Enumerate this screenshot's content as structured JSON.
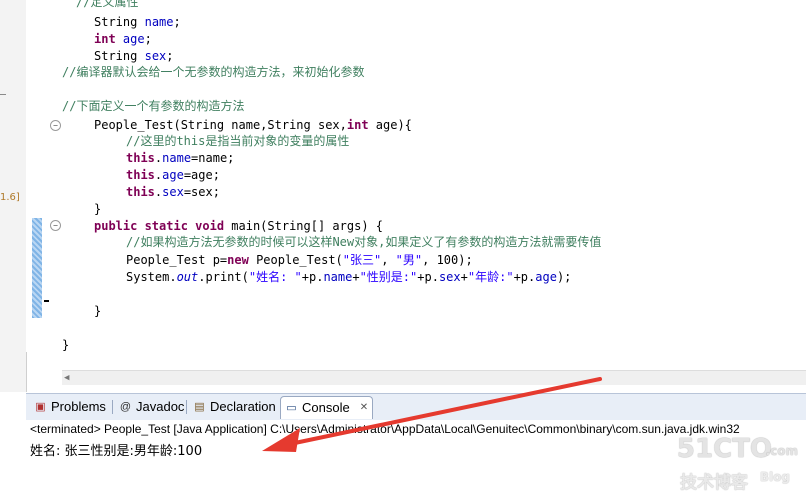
{
  "left_fragment": "1.6]",
  "code": {
    "l0": "//定义属性",
    "l1_type": "String",
    "l1_var": "name",
    "l1_end": ";",
    "l2_type": "int",
    "l2_var": "age",
    "l2_end": ";",
    "l3_type": "String",
    "l3_var": "sex",
    "l3_end": ";",
    "l4": "//编译器默认会给一个无参数的构造方法，来初始化参数",
    "l5": "//下面定义一个有参数的构造方法",
    "l6a": "People_Test(String name,String sex,",
    "l6b": "int",
    "l6c": " age){",
    "l7": "//这里的this是指当前对象的变量的属性",
    "l8a": "this",
    "l8b": ".",
    "l8c": "name",
    "l8d": "=name;",
    "l9a": "this",
    "l9b": ".",
    "l9c": "age",
    "l9d": "=age;",
    "l10a": "this",
    "l10b": ".",
    "l10c": "sex",
    "l10d": "=sex;",
    "l11": "}",
    "l12a": "public static void",
    "l12b": " main(String[] args) {",
    "l13": "//如果构造方法无参数的时候可以这样New对象,如果定义了有参数的构造方法就需要传值",
    "l14a": "People_Test p=",
    "l14b": "new",
    "l14c": " People_Test(",
    "l14d": "\"张三\"",
    "l14e": ", ",
    "l14f": "\"男\"",
    "l14g": ", 100);",
    "l15a": "System.",
    "l15b": "out",
    "l15c": ".print(",
    "l15d": "\"姓名: \"",
    "l15e": "+p.",
    "l15f": "name",
    "l15g": "+",
    "l15h": "\"性别是:\"",
    "l15i": "+p.",
    "l15j": "sex",
    "l15k": "+",
    "l15l": "\"年龄:\"",
    "l15m": "+p.",
    "l15n": "age",
    "l15o": ");",
    "l16": "}",
    "l17": "}"
  },
  "tabs": [
    {
      "label": "Problems",
      "icon": "problems-icon"
    },
    {
      "label": "Javadoc",
      "icon": "at-icon"
    },
    {
      "label": "Declaration",
      "icon": "declaration-icon"
    },
    {
      "label": "Console",
      "icon": "console-icon",
      "active": true
    }
  ],
  "tab_close": "✕",
  "console": {
    "terminated": "<terminated> People_Test [Java Application] C:\\Users\\Administrator\\AppData\\Local\\Genuitec\\Common\\binary\\com.sun.java.jdk.win32",
    "output": "姓名: 张三性别是:男年龄:100"
  },
  "watermark": {
    "main": "51CTO",
    "com": ".com",
    "sub": "技术博客",
    "blog": "Blog"
  },
  "colors": {
    "keyword": "#7f0055",
    "field": "#0000c0",
    "comment": "#3f7f5f",
    "string": "#2a00ff",
    "arrow": "#e53a2f"
  }
}
